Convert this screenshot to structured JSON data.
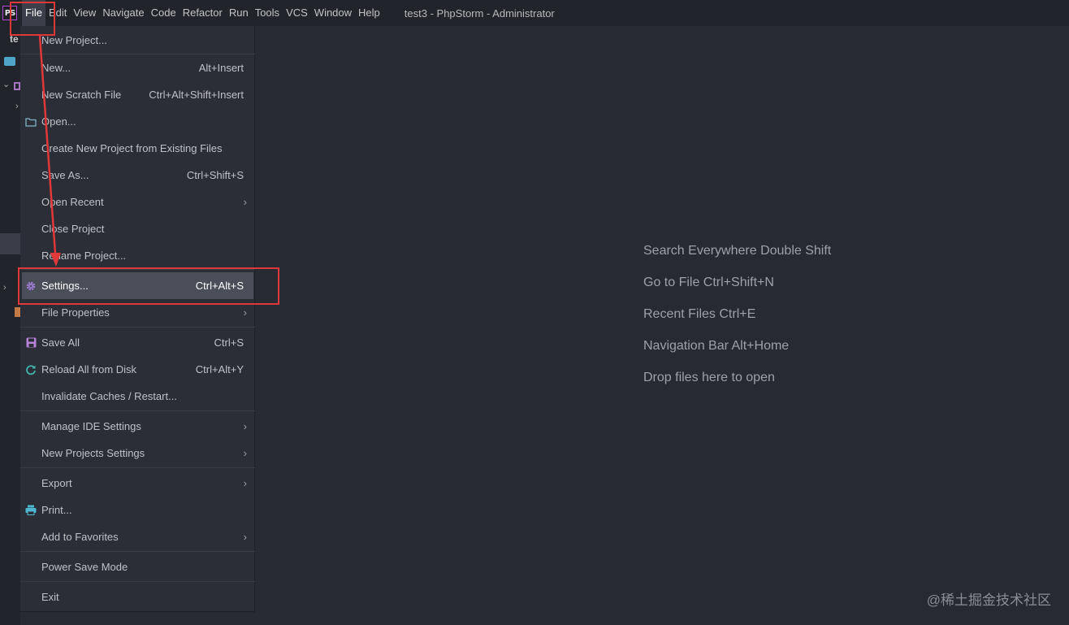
{
  "app": {
    "icon_text": "PS",
    "window_title": "test3 - PhpStorm - Administrator"
  },
  "menubar": {
    "items": [
      "File",
      "Edit",
      "View",
      "Navigate",
      "Code",
      "Refactor",
      "Run",
      "Tools",
      "VCS",
      "Window",
      "Help"
    ]
  },
  "left_strip": {
    "text": "te"
  },
  "file_menu": {
    "items": [
      {
        "label": "New Project...",
        "shortcut": ""
      },
      {
        "label": "New...",
        "shortcut": "Alt+Insert"
      },
      {
        "label": "New Scratch File",
        "shortcut": "Ctrl+Alt+Shift+Insert"
      },
      {
        "label": "Open...",
        "shortcut": "",
        "icon": "folder-icon"
      },
      {
        "label": "Create New Project from Existing Files",
        "shortcut": ""
      },
      {
        "label": "Save As...",
        "shortcut": "Ctrl+Shift+S"
      },
      {
        "label": "Open Recent",
        "shortcut": "",
        "submenu": true
      },
      {
        "label": "Close Project",
        "shortcut": ""
      },
      {
        "label": "Rename Project...",
        "shortcut": ""
      },
      {
        "label": "Settings...",
        "shortcut": "Ctrl+Alt+S",
        "icon": "gear-icon",
        "selected": true
      },
      {
        "label": "File Properties",
        "shortcut": "",
        "submenu": true
      },
      {
        "label": "Save All",
        "shortcut": "Ctrl+S",
        "icon": "save-icon"
      },
      {
        "label": "Reload All from Disk",
        "shortcut": "Ctrl+Alt+Y",
        "icon": "reload-icon"
      },
      {
        "label": "Invalidate Caches / Restart...",
        "shortcut": ""
      },
      {
        "label": "Manage IDE Settings",
        "shortcut": "",
        "submenu": true
      },
      {
        "label": "New Projects Settings",
        "shortcut": "",
        "submenu": true
      },
      {
        "label": "Export",
        "shortcut": "",
        "submenu": true
      },
      {
        "label": "Print...",
        "shortcut": "",
        "icon": "print-icon"
      },
      {
        "label": "Add to Favorites",
        "shortcut": "",
        "submenu": true
      },
      {
        "label": "Power Save Mode",
        "shortcut": ""
      },
      {
        "label": "Exit",
        "shortcut": ""
      }
    ]
  },
  "editor_hints": {
    "items": [
      "Search Everywhere  Double Shift",
      "Go to File  Ctrl+Shift+N",
      "Recent Files  Ctrl+E",
      "Navigation Bar  Alt+Home",
      "Drop files here to open"
    ]
  },
  "watermark": "@稀土掘金技术社区",
  "colors": {
    "background": "#272a33",
    "menubar": "#21242b",
    "menu": "#2b2e36",
    "selected": "#4a4e58",
    "annotation": "#e03838",
    "gear_icon": "#a07dd6",
    "save_icon": "#b882d6",
    "reload_icon": "#3fb6b0",
    "print_icon": "#4fb6d2",
    "folder_icon": "#7fb3c9"
  }
}
